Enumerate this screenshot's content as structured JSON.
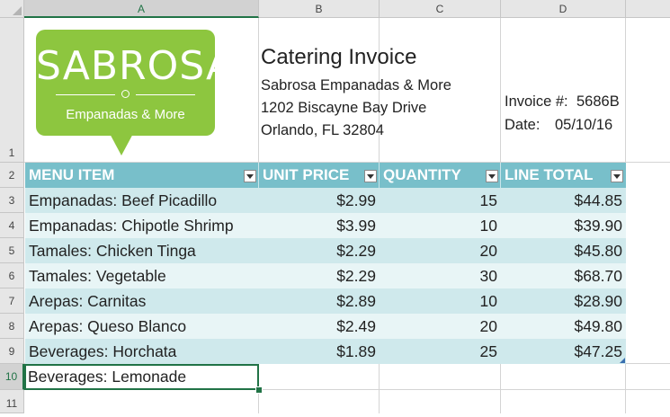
{
  "columns": [
    "A",
    "B",
    "C",
    "D"
  ],
  "rows": [
    "1",
    "2",
    "3",
    "4",
    "5",
    "6",
    "7",
    "8",
    "9",
    "10",
    "11"
  ],
  "logo": {
    "title": "SABROSA",
    "subtitle": "Empanadas & More",
    "color": "#8dc63f"
  },
  "header": {
    "title": "Catering Invoice",
    "company": "Sabrosa Empanadas & More",
    "street": "1202 Biscayne Bay Drive",
    "city": "Orlando, FL 32804",
    "invoice_label": "Invoice #:",
    "invoice_value": "5686B",
    "date_label": "Date:",
    "date_value": "05/10/16"
  },
  "table": {
    "headers": [
      "MENU ITEM",
      "UNIT PRICE",
      "QUANTITY",
      "LINE TOTAL"
    ],
    "header_color": "#78bfca",
    "rows": [
      {
        "item": "Empanadas: Beef Picadillo",
        "price": "$2.99",
        "qty": "15",
        "total": "$44.85"
      },
      {
        "item": "Empanadas: Chipotle Shrimp",
        "price": "$3.99",
        "qty": "10",
        "total": "$39.90"
      },
      {
        "item": "Tamales: Chicken Tinga",
        "price": "$2.29",
        "qty": "20",
        "total": "$45.80"
      },
      {
        "item": "Tamales: Vegetable",
        "price": "$2.29",
        "qty": "30",
        "total": "$68.70"
      },
      {
        "item": "Arepas: Carnitas",
        "price": "$2.89",
        "qty": "10",
        "total": "$28.90"
      },
      {
        "item": "Arepas: Queso Blanco",
        "price": "$2.49",
        "qty": "20",
        "total": "$49.80"
      },
      {
        "item": "Beverages: Horchata",
        "price": "$1.89",
        "qty": "25",
        "total": "$47.25"
      }
    ]
  },
  "active_cell": {
    "ref": "A10",
    "value": "Beverages: Lemonade"
  },
  "selection_color": "#217346"
}
